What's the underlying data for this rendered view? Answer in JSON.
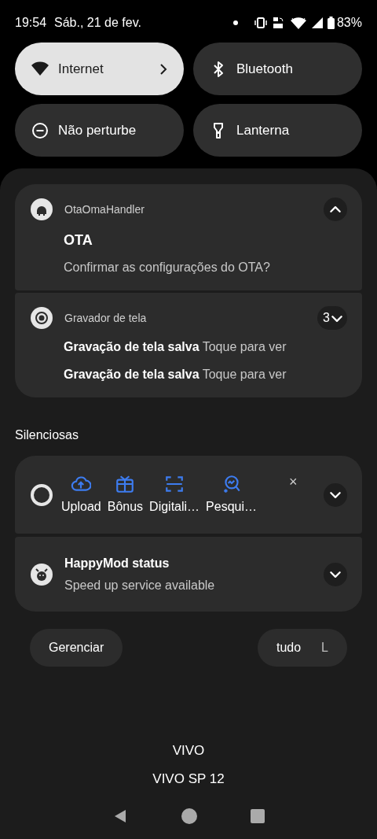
{
  "status_bar": {
    "time": "19:54",
    "date": "Sáb., 21 de fev.",
    "battery": "83%"
  },
  "tiles": [
    {
      "label": "Internet",
      "kind": "wifi",
      "on": true
    },
    {
      "label": "Bluetooth",
      "kind": "bluetooth",
      "on": false
    },
    {
      "label": "Não perturbe",
      "kind": "dnd",
      "on": false
    },
    {
      "label": "Lanterna",
      "kind": "flashlight",
      "on": false
    }
  ],
  "notifications": [
    {
      "kind": "standard",
      "app": "OtaOmaHandler",
      "expanded": true,
      "title": "OTA",
      "text": "Confirmar as configurações do OTA?"
    },
    {
      "kind": "group",
      "app": "Gravador de tela",
      "expanded": false,
      "count": "3",
      "lines": [
        {
          "title": "Gravação de tela salva",
          "text": "Toque para ver"
        },
        {
          "title": "Gravação de tela salva",
          "text": "Toque para ver"
        }
      ]
    }
  ],
  "silent_header": "Silenciosas",
  "silent_notifications": [
    {
      "kind": "actions",
      "expanded": false,
      "close": "×",
      "actions": [
        {
          "label": "Upload"
        },
        {
          "label": "Bônus"
        },
        {
          "label": "Digitali…"
        },
        {
          "label": "Pesqui…"
        }
      ]
    },
    {
      "kind": "standard",
      "expanded": false,
      "title": "HappyMod status",
      "text": "Speed up service available"
    }
  ],
  "footer_buttons": [
    {
      "label": "Gerenciar"
    },
    {
      "label": "tudo",
      "tail": "L"
    }
  ],
  "carrier": [
    "VIVO",
    "VIVO SP 12"
  ]
}
